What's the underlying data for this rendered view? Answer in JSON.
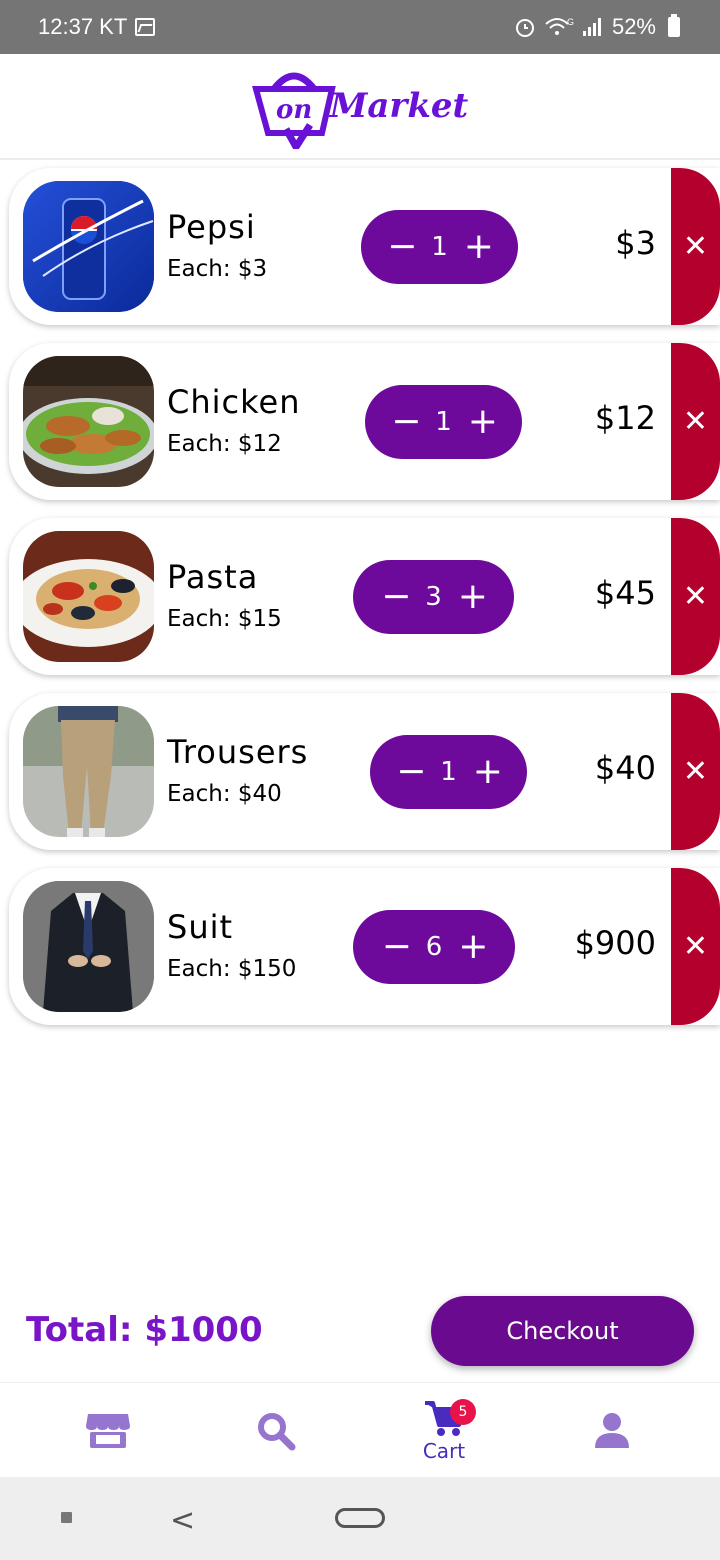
{
  "status_bar": {
    "time": "12:37 KT",
    "battery": "52%"
  },
  "header": {
    "logo_text": "Market",
    "logo_prefix": "on"
  },
  "cart": {
    "items": [
      {
        "name": "Pepsi",
        "each": "Each: $3",
        "qty": "1",
        "total": "$3"
      },
      {
        "name": "Chicken",
        "each": "Each: $12",
        "qty": "1",
        "total": "$12"
      },
      {
        "name": "Pasta",
        "each": "Each: $15",
        "qty": "3",
        "total": "$45"
      },
      {
        "name": "Trousers",
        "each": "Each: $40",
        "qty": "1",
        "total": "$40"
      },
      {
        "name": "Suit",
        "each": "Each: $150",
        "qty": "6",
        "total": "$900"
      }
    ],
    "decrement": "−",
    "increment": "+",
    "remove": "✕"
  },
  "footer": {
    "total": "Total: $1000",
    "checkout_label": "Checkout"
  },
  "bottom_nav": {
    "cart_label": "Cart",
    "cart_badge": "5"
  },
  "colors": {
    "accent": "#6d0a9c",
    "remove": "#b3002d",
    "nav": "#9575cd",
    "badge": "#e8134a"
  }
}
